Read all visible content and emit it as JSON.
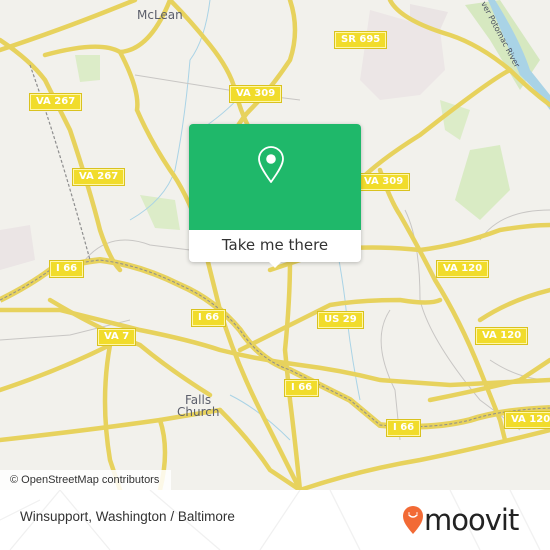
{
  "map": {
    "places": [
      {
        "name": "McLean",
        "id": "mclean"
      },
      {
        "name": "Falls",
        "id": "falls"
      },
      {
        "name": "Church",
        "id": "church"
      }
    ],
    "river_label": "ver Potomac River",
    "road_shields": [
      {
        "id": "sr695",
        "label": "SR 695"
      },
      {
        "id": "va309a",
        "label": "VA 309"
      },
      {
        "id": "va309b",
        "label": "VA 309"
      },
      {
        "id": "va267a",
        "label": "VA 267"
      },
      {
        "id": "va267b",
        "label": "VA 267"
      },
      {
        "id": "i66a",
        "label": "I 66"
      },
      {
        "id": "i66b",
        "label": "I 66"
      },
      {
        "id": "i66c",
        "label": "I 66"
      },
      {
        "id": "i66d",
        "label": "I 66"
      },
      {
        "id": "va7",
        "label": "VA 7"
      },
      {
        "id": "us29",
        "label": "US 29"
      },
      {
        "id": "va120a",
        "label": "VA 120"
      },
      {
        "id": "va120b",
        "label": "VA 120"
      },
      {
        "id": "va120c",
        "label": "VA 120"
      }
    ],
    "attribution": "© OpenStreetMap contributors"
  },
  "popup": {
    "button_label": "Take me there",
    "icon": "map-pin-icon",
    "accent_color": "#1fb86a"
  },
  "footer": {
    "title": "Winsupport, Washington / Baltimore",
    "logo_text": "moovit",
    "logo_color": "#f26a35"
  }
}
